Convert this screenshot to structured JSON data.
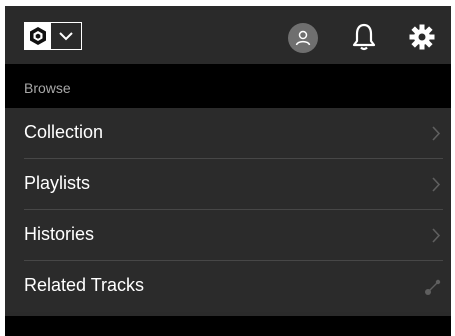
{
  "topbar": {
    "logo": "brand-logo-icon",
    "menu_icon": "chevron-down-icon",
    "avatar_icon": "user-avatar-icon",
    "notification_icon": "bell-icon",
    "settings_icon": "gear-icon"
  },
  "browse": {
    "title": "Browse",
    "items": [
      {
        "label": "Collection",
        "icon": "chevron-right-icon"
      },
      {
        "label": "Playlists",
        "icon": "chevron-right-icon"
      },
      {
        "label": "Histories",
        "icon": "chevron-right-icon"
      },
      {
        "label": "Related Tracks",
        "icon": "related-link-icon"
      }
    ]
  },
  "colors": {
    "background": "#2a2a2a",
    "section_header": "#000000",
    "text": "#ffffff",
    "muted_text": "#a8a8a8",
    "divider": "#474747"
  }
}
